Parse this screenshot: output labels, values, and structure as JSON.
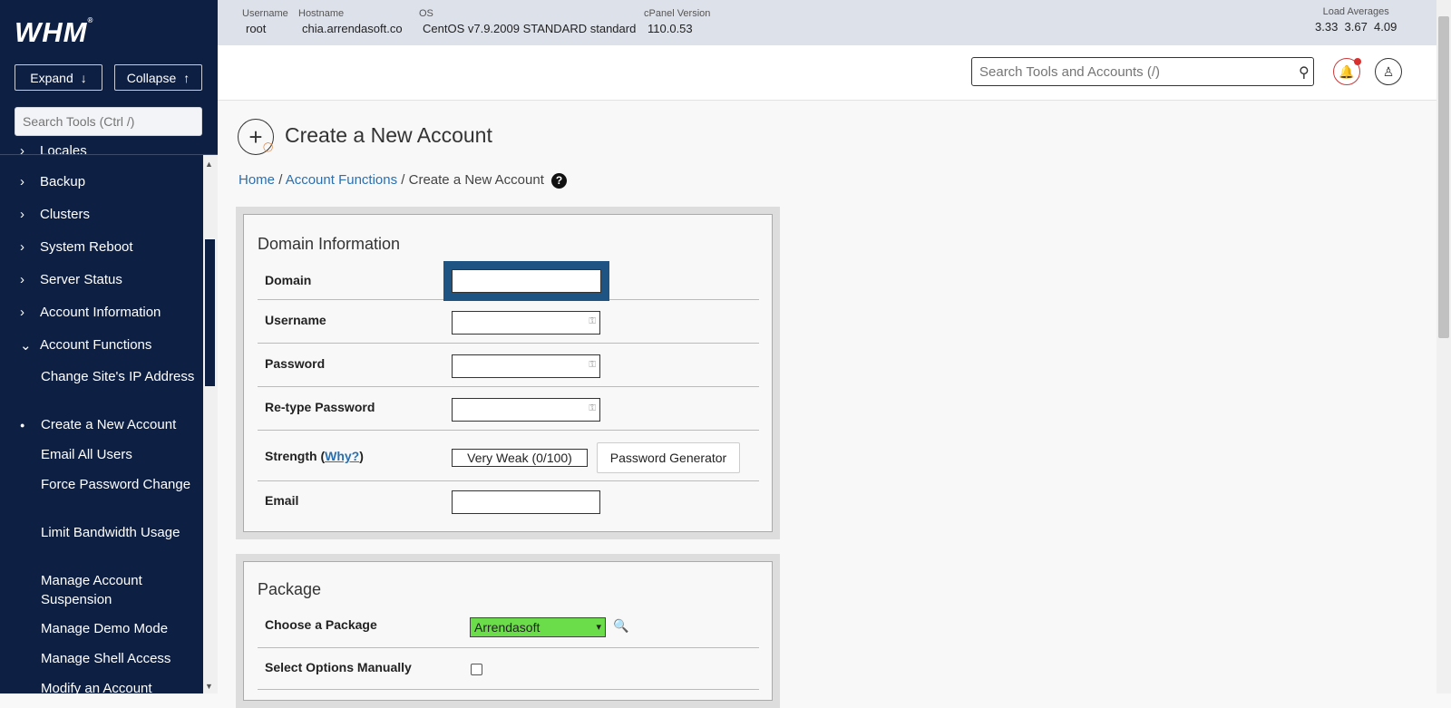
{
  "app": {
    "logo": "WHM",
    "logo_mark": "®"
  },
  "sidebar": {
    "expand_label": "Expand",
    "collapse_label": "Collapse",
    "search_placeholder": "Search Tools (Ctrl /)",
    "partial_item": "Locales",
    "items": [
      {
        "label": "Backup"
      },
      {
        "label": "Clusters"
      },
      {
        "label": "System Reboot"
      },
      {
        "label": "Server Status"
      },
      {
        "label": "Account Information"
      },
      {
        "label": "Account Functions"
      }
    ],
    "subitems": [
      {
        "label": "Change Site's IP Address"
      },
      {
        "label": "Create a New Account"
      },
      {
        "label": "Email All Users"
      },
      {
        "label": "Force Password Change"
      },
      {
        "label": "Limit Bandwidth Usage"
      },
      {
        "label": "Manage Account Suspension"
      },
      {
        "label": "Manage Demo Mode"
      },
      {
        "label": "Manage Shell Access"
      },
      {
        "label": "Modify an Account"
      }
    ]
  },
  "topbar": {
    "username_label": "Username",
    "username": "root",
    "hostname_label": "Hostname",
    "hostname": "chia.arrendasoft.co",
    "os_label": "OS",
    "os": "CentOS v7.9.2009 STANDARD standard",
    "cpanel_label": "cPanel Version",
    "cpanel": "110.0.53",
    "load_label": "Load Averages",
    "load": "3.33  3.67  4.09"
  },
  "header": {
    "search_placeholder": "Search Tools and Accounts (/)"
  },
  "page": {
    "title": "Create a New Account",
    "breadcrumb": {
      "home": "Home",
      "section": "Account Functions",
      "current": "Create a New Account",
      "sep": "/"
    },
    "help": "?"
  },
  "domain_info": {
    "title": "Domain Information",
    "domain_label": "Domain",
    "username_label": "Username",
    "password_label": "Password",
    "retype_label": "Re-type Password",
    "strength_label": "Strength (",
    "why": "Why?",
    "strength_close": ")",
    "strength_value": "Very Weak (0/100)",
    "pw_generator": "Password Generator",
    "email_label": "Email"
  },
  "package": {
    "title": "Package",
    "choose_label": "Choose a Package",
    "selected": "Arrendasoft",
    "manual_label": "Select Options Manually"
  },
  "colors": {
    "sidebar_bg": "#0d1f43",
    "focus": "#1e5483",
    "package_select": "#6bdc4a",
    "link": "#2a6fb0"
  }
}
